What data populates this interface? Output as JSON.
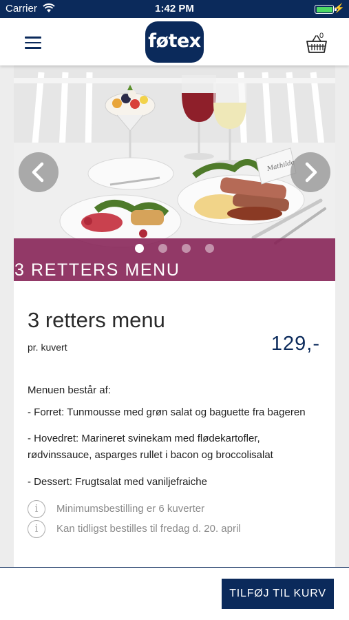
{
  "status_bar": {
    "carrier": "Carrier",
    "time": "1:42 PM",
    "battery_color": "#4cd964"
  },
  "nav": {
    "logo_text": "føtex",
    "basket_count": "0",
    "brand_color": "#0b2a5b"
  },
  "hero": {
    "title": "3 RETTERS MENU",
    "band_color": "#852054",
    "slide_count": 4,
    "active_slide": 1,
    "place_card_text": "Mathilde"
  },
  "product": {
    "title": "3 retters menu",
    "per_unit": "pr. kuvert",
    "price": "129,-"
  },
  "description": {
    "intro": "Menuen består af:",
    "starter": "- Forret: Tunmousse med grøn salat og baguette fra bageren",
    "main": "- Hovedret: Marineret svinekam med flødekartofler, rødvinssauce, asparges rullet i bacon og broccolisalat",
    "dessert": "- Dessert: Frugtsalat med vaniljefraiche"
  },
  "info": {
    "icon_glyph": "i",
    "minimum": "Minimumsbestilling er 6 kuverter",
    "earliest": "Kan tidligst bestilles til fredag d. 20. april"
  },
  "actions": {
    "add_to_cart": "TILFØJ TIL KURV"
  }
}
